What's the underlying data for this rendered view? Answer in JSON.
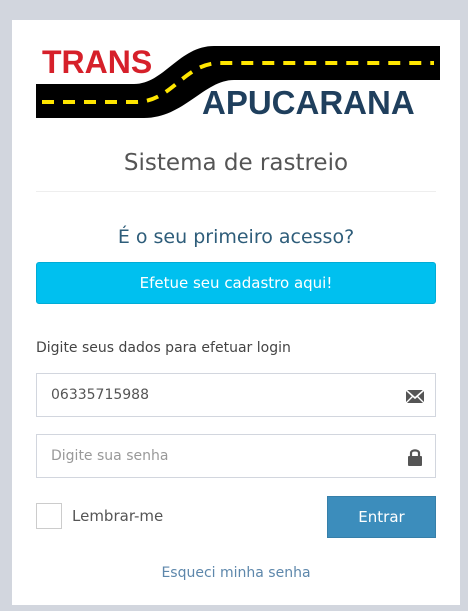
{
  "brand": {
    "logo_top": "TRANS",
    "logo_bottom": "APUCARANA",
    "colors": {
      "red": "#d6202a",
      "road": "#000000",
      "navy": "#1f3f5d",
      "stripe": "#ffe600"
    }
  },
  "subtitle": "Sistema de rastreio",
  "signup": {
    "question": "É o seu primeiro acesso?",
    "button_label": "Efetue seu cadastro aqui!"
  },
  "login": {
    "instruction": "Digite seus dados para efetuar login",
    "user_value": "06335715988",
    "user_icon": "envelope-icon",
    "password_placeholder": "Digite sua senha",
    "password_icon": "lock-icon",
    "remember_label": "Lembrar-me",
    "submit_label": "Entrar",
    "forgot_label": "Esqueci minha senha"
  }
}
